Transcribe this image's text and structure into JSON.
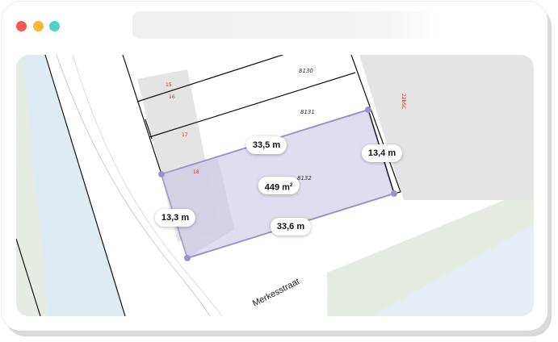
{
  "window": {
    "traffic_lights": [
      {
        "name": "close",
        "color": "#f05a5a"
      },
      {
        "name": "minimize",
        "color": "#f7b731"
      },
      {
        "name": "maximize",
        "color": "#4fd1c5"
      }
    ]
  },
  "map": {
    "street_name": "Merkesstraat",
    "parcels": [
      {
        "number": "8130"
      },
      {
        "number": "8131"
      },
      {
        "number": "8132"
      }
    ],
    "house_numbers": [
      "15",
      "16",
      "17",
      "18",
      "22b5C"
    ],
    "colors": {
      "water": "#deebf3",
      "green": "#e6ece4",
      "building": "#e4e4e4",
      "selection_fill": "#ddd9ee",
      "selection_stroke": "#9b93c7"
    }
  },
  "measurements": {
    "top_edge": "33,5 m",
    "right_edge": "13,4 m",
    "left_edge": "13,3 m",
    "bottom_edge": "33,6 m",
    "area_number": "449 m",
    "area_unit_sup": "2"
  }
}
